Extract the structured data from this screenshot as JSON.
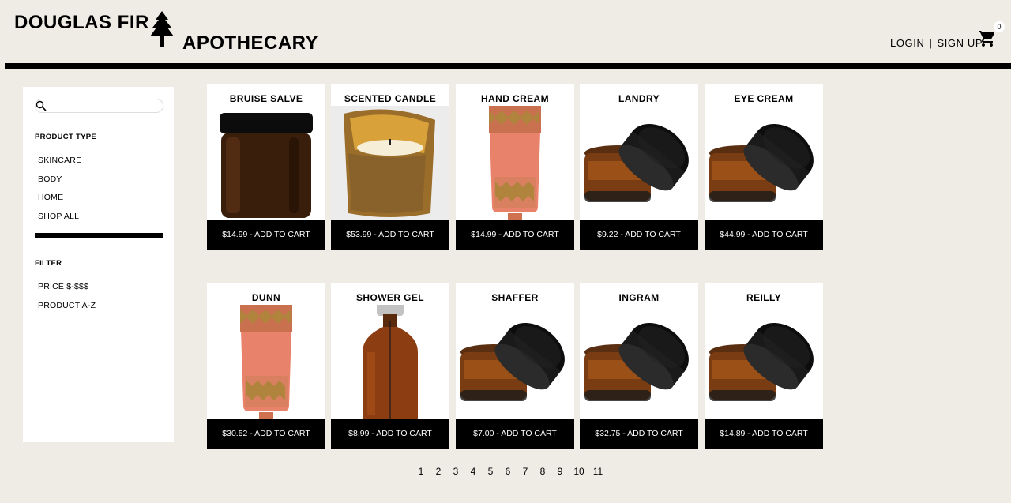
{
  "header": {
    "logo_line1": "DOUGLAS FIR",
    "logo_line2": "APOTHECARY",
    "logo_icon": "pine-tree-icon",
    "login": "LOGIN",
    "separator": "|",
    "signup": "SIGN UP",
    "cart_icon": "shopping-cart-icon",
    "cart_count": "0"
  },
  "sidebar": {
    "search_placeholder": "",
    "product_type_heading": "PRODUCT TYPE",
    "product_types": [
      "SKINCARE",
      "BODY",
      "HOME",
      "SHOP ALL"
    ],
    "filter_heading": "FILTER",
    "filters": [
      "PRICE $-$$$",
      "PRODUCT A-Z"
    ]
  },
  "products": [
    {
      "name": "BRUISE SALVE",
      "button": "$14.99 - ADD TO CART",
      "image": "amber-jar"
    },
    {
      "name": "SCENTED CANDLE",
      "button": "$53.99 - ADD TO CART",
      "image": "candle"
    },
    {
      "name": "HAND CREAM",
      "button": "$14.99 - ADD TO CART",
      "image": "tube"
    },
    {
      "name": "LANDRY",
      "button": "$9.22 - ADD TO CART",
      "image": "open-jar"
    },
    {
      "name": "EYE CREAM",
      "button": "$44.99 - ADD TO CART",
      "image": "open-jar"
    },
    {
      "name": "DUNN",
      "button": "$30.52 - ADD TO CART",
      "image": "tube"
    },
    {
      "name": "SHOWER GEL",
      "button": "$8.99 - ADD TO CART",
      "image": "pump-bottle"
    },
    {
      "name": "SHAFFER",
      "button": "$7.00 - ADD TO CART",
      "image": "open-jar"
    },
    {
      "name": "INGRAM",
      "button": "$32.75 - ADD TO CART",
      "image": "open-jar"
    },
    {
      "name": "REILLY",
      "button": "$14.89 - ADD TO CART",
      "image": "open-jar"
    }
  ],
  "pagination": [
    "1",
    "2",
    "3",
    "4",
    "5",
    "6",
    "7",
    "8",
    "9",
    "10",
    "11"
  ]
}
